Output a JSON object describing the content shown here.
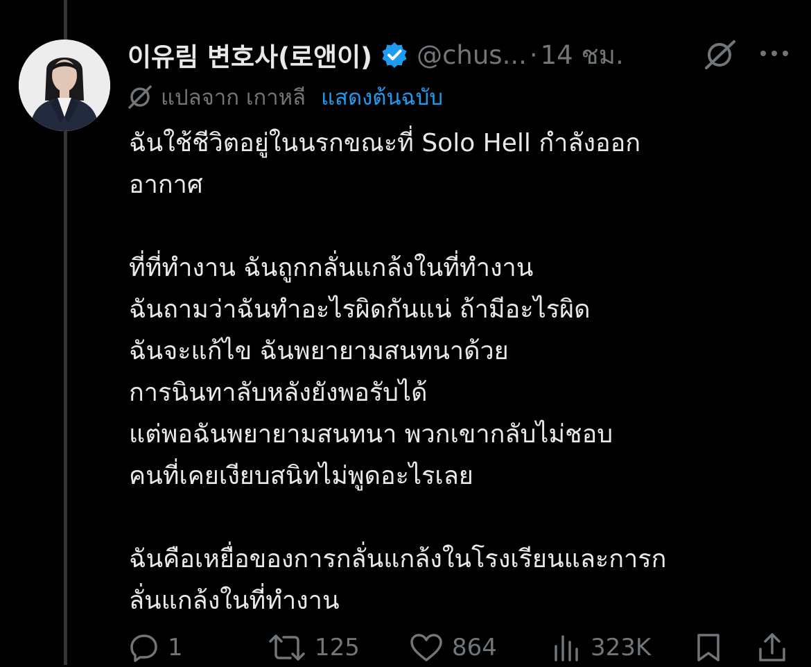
{
  "post": {
    "author": {
      "display_name": "이유림 변호사(로앤이)",
      "handle": "@chus...",
      "verified": true
    },
    "separator": "·",
    "time": "14 ชม.",
    "translation": {
      "label": "แปลจาก เกาหลี",
      "show_original": "แสดงต้นฉบับ"
    },
    "text": {
      "para1": [
        "ฉันใช้ชีวิตอยู่ในนรกขณะที่ Solo Hell กำลังออก",
        "อากาศ"
      ],
      "para2": [
        "ที่ที่ทำงาน ฉันถูกกลั่นแกล้งในที่ทำงาน",
        "ฉันถามว่าฉันทำอะไรผิดกันแน่ ถ้ามีอะไรผิด",
        "ฉันจะแก้ไข ฉันพยายามสนทนาด้วย",
        "การนินทาลับหลังยังพอรับได้",
        "แต่พอฉันพยายามสนทนา พวกเขากลับไม่ชอบ",
        "คนที่เคยเงียบสนิทไม่พูดอะไรเลย"
      ],
      "para3": [
        "ฉันคือเหยื่อของการกลั่นแกล้งในโรงเรียนและการก",
        "ลั่นแกล้งในที่ทำงาน"
      ]
    },
    "actions": {
      "replies": "1",
      "reposts": "125",
      "likes": "864",
      "views": "323K"
    }
  },
  "icons": {
    "verified": "verified-badge-icon",
    "grok": "grok-icon",
    "more": "more-icon",
    "translate": "translate-icon",
    "reply": "reply-icon",
    "repost": "repost-icon",
    "like": "heart-icon",
    "views": "views-icon",
    "bookmark": "bookmark-icon",
    "share": "share-icon"
  },
  "colors": {
    "background": "#000000",
    "text": "#e7e9ea",
    "muted": "#71767b",
    "accent": "#1d9bf0",
    "thread_line": "#333639"
  }
}
